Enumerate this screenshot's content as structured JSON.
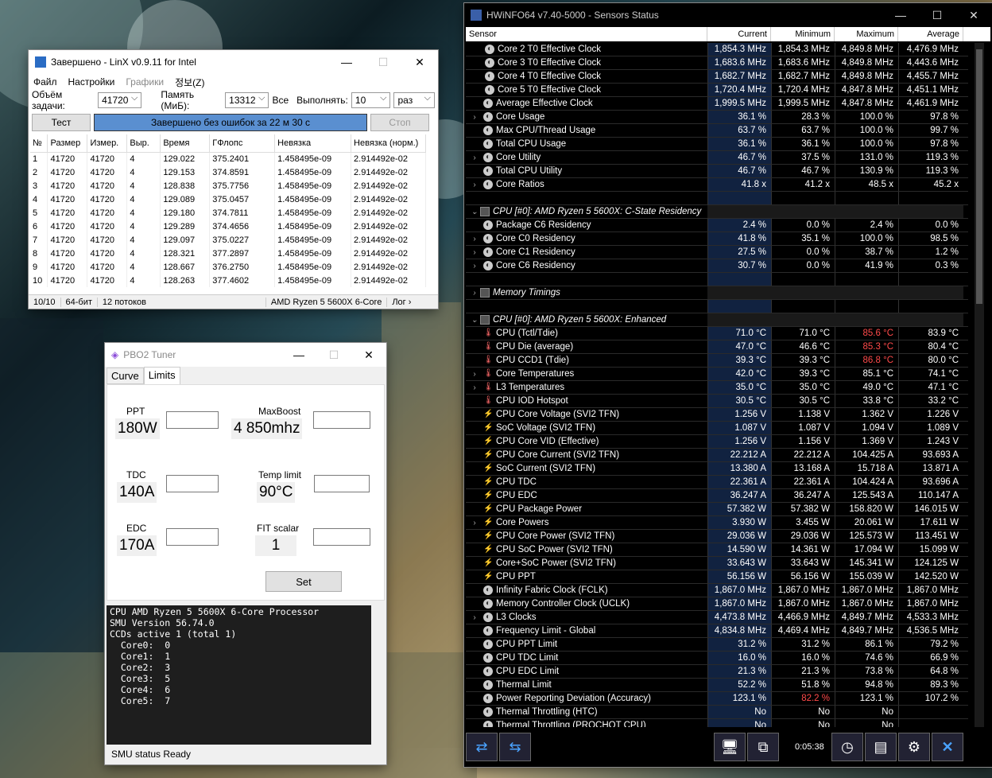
{
  "linx": {
    "title": "Завершено - LinX v0.9.11 for Intel",
    "menu": [
      "Файл",
      "Настройки",
      "Графики",
      "정보(Z)"
    ],
    "problem_label": "Объём задачи:",
    "problem_value": "41720",
    "memory_label": "Память (МиБ):",
    "memory_value": "13312",
    "all_label": "Все",
    "run_label": "Выполнять:",
    "run_value": "10",
    "run_unit": "раз",
    "test_button": "Тест",
    "progress_text": "Завершено без ошибок за 22 м 30 с",
    "stop_button": "Стоп",
    "columns": [
      "№",
      "Размер",
      "Измер.",
      "Выр.",
      "Время",
      "ГФлопс",
      "Невязка",
      "Невязка (норм.)"
    ],
    "rows": [
      [
        "1",
        "41720",
        "41720",
        "4",
        "129.022",
        "375.2401",
        "1.458495e-09",
        "2.914492e-02"
      ],
      [
        "2",
        "41720",
        "41720",
        "4",
        "129.153",
        "374.8591",
        "1.458495e-09",
        "2.914492e-02"
      ],
      [
        "3",
        "41720",
        "41720",
        "4",
        "128.838",
        "375.7756",
        "1.458495e-09",
        "2.914492e-02"
      ],
      [
        "4",
        "41720",
        "41720",
        "4",
        "129.089",
        "375.0457",
        "1.458495e-09",
        "2.914492e-02"
      ],
      [
        "5",
        "41720",
        "41720",
        "4",
        "129.180",
        "374.7811",
        "1.458495e-09",
        "2.914492e-02"
      ],
      [
        "6",
        "41720",
        "41720",
        "4",
        "129.289",
        "374.4656",
        "1.458495e-09",
        "2.914492e-02"
      ],
      [
        "7",
        "41720",
        "41720",
        "4",
        "129.097",
        "375.0227",
        "1.458495e-09",
        "2.914492e-02"
      ],
      [
        "8",
        "41720",
        "41720",
        "4",
        "128.321",
        "377.2897",
        "1.458495e-09",
        "2.914492e-02"
      ],
      [
        "9",
        "41720",
        "41720",
        "4",
        "128.667",
        "376.2750",
        "1.458495e-09",
        "2.914492e-02"
      ],
      [
        "10",
        "41720",
        "41720",
        "4",
        "128.263",
        "377.4602",
        "1.458495e-09",
        "2.914492e-02"
      ]
    ],
    "status": [
      "10/10",
      "64-бит",
      "12 потоков",
      "AMD Ryzen 5 5600X 6-Core",
      "Лог ›"
    ]
  },
  "pbo": {
    "title": "PBO2 Tuner",
    "tabs": [
      "Curve",
      "Limits"
    ],
    "ppt_label": "PPT",
    "ppt_value": "180W",
    "maxboost_label": "MaxBoost",
    "maxboost_value": "4 850mhz",
    "tdc_label": "TDC",
    "tdc_value": "140A",
    "temp_label": "Temp limit",
    "temp_value": "90°C",
    "edc_label": "EDC",
    "edc_value": "170A",
    "fit_label": "FIT scalar",
    "fit_value": "1",
    "set_button": "Set",
    "console": "CPU AMD Ryzen 5 5600X 6-Core Processor\nSMU Version 56.74.0\nCCDs active 1 (total 1)\n  Core0:  0\n  Core1:  1\n  Core2:  3\n  Core3:  5\n  Core4:  6\n  Core5:  7",
    "status": "SMU status Ready"
  },
  "hw": {
    "title": "HWiNFO64 v7.40-5000 - Sensors Status",
    "headers": [
      "Sensor",
      "Current",
      "Minimum",
      "Maximum",
      "Average"
    ],
    "time": "0:05:38",
    "rows": [
      {
        "i": "clk",
        "ind": 2,
        "n": "Core 2 T0 Effective Clock",
        "v": [
          "1,854.3 MHz",
          "1,854.3 MHz",
          "4,849.8 MHz",
          "4,476.9 MHz"
        ]
      },
      {
        "i": "clk",
        "ind": 2,
        "n": "Core 3 T0 Effective Clock",
        "v": [
          "1,683.6 MHz",
          "1,683.6 MHz",
          "4,849.8 MHz",
          "4,443.6 MHz"
        ]
      },
      {
        "i": "clk",
        "ind": 2,
        "n": "Core 4 T0 Effective Clock",
        "v": [
          "1,682.7 MHz",
          "1,682.7 MHz",
          "4,849.8 MHz",
          "4,455.7 MHz"
        ]
      },
      {
        "i": "clk",
        "ind": 2,
        "n": "Core 5 T0 Effective Clock",
        "v": [
          "1,720.4 MHz",
          "1,720.4 MHz",
          "4,847.8 MHz",
          "4,451.1 MHz"
        ]
      },
      {
        "i": "clk",
        "ind": 1,
        "n": "Average Effective Clock",
        "v": [
          "1,999.5 MHz",
          "1,999.5 MHz",
          "4,847.8 MHz",
          "4,461.9 MHz"
        ]
      },
      {
        "i": "clk",
        "ind": 1,
        "x": 1,
        "n": "Core Usage",
        "v": [
          "36.1 %",
          "28.3 %",
          "100.0 %",
          "97.8 %"
        ]
      },
      {
        "i": "clk",
        "ind": 1,
        "n": "Max CPU/Thread Usage",
        "v": [
          "63.7 %",
          "63.7 %",
          "100.0 %",
          "99.7 %"
        ]
      },
      {
        "i": "clk",
        "ind": 1,
        "n": "Total CPU Usage",
        "v": [
          "36.1 %",
          "36.1 %",
          "100.0 %",
          "97.8 %"
        ]
      },
      {
        "i": "clk",
        "ind": 1,
        "x": 1,
        "n": "Core Utility",
        "v": [
          "46.7 %",
          "37.5 %",
          "131.0 %",
          "119.3 %"
        ]
      },
      {
        "i": "clk",
        "ind": 1,
        "n": "Total CPU Utility",
        "v": [
          "46.7 %",
          "46.7 %",
          "130.9 %",
          "119.3 %"
        ]
      },
      {
        "i": "clk",
        "ind": 1,
        "x": 1,
        "n": "Core Ratios",
        "v": [
          "41.8 x",
          "41.2 x",
          "48.5 x",
          "45.2 x"
        ]
      },
      {
        "blank": 1
      },
      {
        "sec": 1,
        "i": "chip",
        "n": "CPU [#0]: AMD Ryzen 5 5600X: C-State Residency",
        "x": 2
      },
      {
        "i": "clk",
        "ind": 1,
        "n": "Package C6 Residency",
        "v": [
          "2.4 %",
          "0.0 %",
          "2.4 %",
          "0.0 %"
        ]
      },
      {
        "i": "clk",
        "ind": 1,
        "x": 1,
        "n": "Core C0 Residency",
        "v": [
          "41.8 %",
          "35.1 %",
          "100.0 %",
          "98.5 %"
        ]
      },
      {
        "i": "clk",
        "ind": 1,
        "x": 1,
        "n": "Core C1 Residency",
        "v": [
          "27.5 %",
          "0.0 %",
          "38.7 %",
          "1.2 %"
        ]
      },
      {
        "i": "clk",
        "ind": 1,
        "x": 1,
        "n": "Core C6 Residency",
        "v": [
          "30.7 %",
          "0.0 %",
          "41.9 %",
          "0.3 %"
        ]
      },
      {
        "blank": 1
      },
      {
        "sec": 1,
        "i": "chip",
        "n": "Memory Timings",
        "x": 1
      },
      {
        "blank": 1
      },
      {
        "sec": 1,
        "i": "chip",
        "n": "CPU [#0]: AMD Ryzen 5 5600X: Enhanced",
        "x": 2
      },
      {
        "i": "tmp",
        "ind": 1,
        "n": "CPU (Tctl/Tdie)",
        "v": [
          "71.0 °C",
          "71.0 °C",
          "85.6 °C",
          "83.9 °C"
        ],
        "r": 2
      },
      {
        "i": "tmp",
        "ind": 1,
        "n": "CPU Die (average)",
        "v": [
          "47.0 °C",
          "46.6 °C",
          "85.3 °C",
          "80.4 °C"
        ],
        "r": 2
      },
      {
        "i": "tmp",
        "ind": 1,
        "n": "CPU CCD1 (Tdie)",
        "v": [
          "39.3 °C",
          "39.3 °C",
          "86.8 °C",
          "80.0 °C"
        ],
        "r": 2
      },
      {
        "i": "tmp",
        "ind": 1,
        "x": 1,
        "n": "Core Temperatures",
        "v": [
          "42.0 °C",
          "39.3 °C",
          "85.1 °C",
          "74.1 °C"
        ]
      },
      {
        "i": "tmp",
        "ind": 1,
        "x": 1,
        "n": "L3 Temperatures",
        "v": [
          "35.0 °C",
          "35.0 °C",
          "49.0 °C",
          "47.1 °C"
        ]
      },
      {
        "i": "tmp",
        "ind": 1,
        "n": "CPU IOD Hotspot",
        "v": [
          "30.5 °C",
          "30.5 °C",
          "33.8 °C",
          "33.2 °C"
        ]
      },
      {
        "i": "vol",
        "ind": 1,
        "n": "CPU Core Voltage (SVI2 TFN)",
        "v": [
          "1.256 V",
          "1.138 V",
          "1.362 V",
          "1.226 V"
        ]
      },
      {
        "i": "vol",
        "ind": 1,
        "n": "SoC Voltage (SVI2 TFN)",
        "v": [
          "1.087 V",
          "1.087 V",
          "1.094 V",
          "1.089 V"
        ]
      },
      {
        "i": "vol",
        "ind": 1,
        "n": "CPU Core VID (Effective)",
        "v": [
          "1.256 V",
          "1.156 V",
          "1.369 V",
          "1.243 V"
        ]
      },
      {
        "i": "vol",
        "ind": 1,
        "n": "CPU Core Current (SVI2 TFN)",
        "v": [
          "22.212 A",
          "22.212 A",
          "104.425 A",
          "93.693 A"
        ]
      },
      {
        "i": "vol",
        "ind": 1,
        "n": "SoC Current (SVI2 TFN)",
        "v": [
          "13.380 A",
          "13.168 A",
          "15.718 A",
          "13.871 A"
        ]
      },
      {
        "i": "vol",
        "ind": 1,
        "n": "CPU TDC",
        "v": [
          "22.361 A",
          "22.361 A",
          "104.424 A",
          "93.696 A"
        ]
      },
      {
        "i": "vol",
        "ind": 1,
        "n": "CPU EDC",
        "v": [
          "36.247 A",
          "36.247 A",
          "125.543 A",
          "110.147 A"
        ]
      },
      {
        "i": "vol",
        "ind": 1,
        "n": "CPU Package Power",
        "v": [
          "57.382 W",
          "57.382 W",
          "158.820 W",
          "146.015 W"
        ]
      },
      {
        "i": "vol",
        "ind": 1,
        "x": 1,
        "n": "Core Powers",
        "v": [
          "3.930 W",
          "3.455 W",
          "20.061 W",
          "17.611 W"
        ]
      },
      {
        "i": "vol",
        "ind": 1,
        "n": "CPU Core Power (SVI2 TFN)",
        "v": [
          "29.036 W",
          "29.036 W",
          "125.573 W",
          "113.451 W"
        ]
      },
      {
        "i": "vol",
        "ind": 1,
        "n": "CPU SoC Power (SVI2 TFN)",
        "v": [
          "14.590 W",
          "14.361 W",
          "17.094 W",
          "15.099 W"
        ]
      },
      {
        "i": "vol",
        "ind": 1,
        "n": "Core+SoC Power (SVI2 TFN)",
        "v": [
          "33.643 W",
          "33.643 W",
          "145.341 W",
          "124.125 W"
        ]
      },
      {
        "i": "vol",
        "ind": 1,
        "n": "CPU PPT",
        "v": [
          "56.156 W",
          "56.156 W",
          "155.039 W",
          "142.520 W"
        ]
      },
      {
        "i": "clk",
        "ind": 1,
        "n": "Infinity Fabric Clock (FCLK)",
        "v": [
          "1,867.0 MHz",
          "1,867.0 MHz",
          "1,867.0 MHz",
          "1,867.0 MHz"
        ]
      },
      {
        "i": "clk",
        "ind": 1,
        "n": "Memory Controller Clock (UCLK)",
        "v": [
          "1,867.0 MHz",
          "1,867.0 MHz",
          "1,867.0 MHz",
          "1,867.0 MHz"
        ]
      },
      {
        "i": "clk",
        "ind": 1,
        "x": 1,
        "n": "L3 Clocks",
        "v": [
          "4,473.8 MHz",
          "4,466.9 MHz",
          "4,849.7 MHz",
          "4,533.3 MHz"
        ]
      },
      {
        "i": "clk",
        "ind": 1,
        "n": "Frequency Limit - Global",
        "v": [
          "4,834.8 MHz",
          "4,469.4 MHz",
          "4,849.7 MHz",
          "4,536.5 MHz"
        ]
      },
      {
        "i": "clk",
        "ind": 1,
        "n": "CPU PPT Limit",
        "v": [
          "31.2 %",
          "31.2 %",
          "86.1 %",
          "79.2 %"
        ]
      },
      {
        "i": "clk",
        "ind": 1,
        "n": "CPU TDC Limit",
        "v": [
          "16.0 %",
          "16.0 %",
          "74.6 %",
          "66.9 %"
        ]
      },
      {
        "i": "clk",
        "ind": 1,
        "n": "CPU EDC Limit",
        "v": [
          "21.3 %",
          "21.3 %",
          "73.8 %",
          "64.8 %"
        ]
      },
      {
        "i": "clk",
        "ind": 1,
        "n": "Thermal Limit",
        "v": [
          "52.2 %",
          "51.8 %",
          "94.8 %",
          "89.3 %"
        ]
      },
      {
        "i": "clk",
        "ind": 1,
        "n": "Power Reporting Deviation (Accuracy)",
        "v": [
          "123.1 %",
          "82.2 %",
          "123.1 %",
          "107.2 %"
        ],
        "r": 1
      },
      {
        "i": "clk",
        "ind": 1,
        "n": "Thermal Throttling (HTC)",
        "v": [
          "No",
          "No",
          "No",
          ""
        ]
      },
      {
        "i": "clk",
        "ind": 1,
        "n": "Thermal Throttling (PROCHOT CPU)",
        "v": [
          "No",
          "No",
          "No",
          ""
        ]
      }
    ]
  }
}
